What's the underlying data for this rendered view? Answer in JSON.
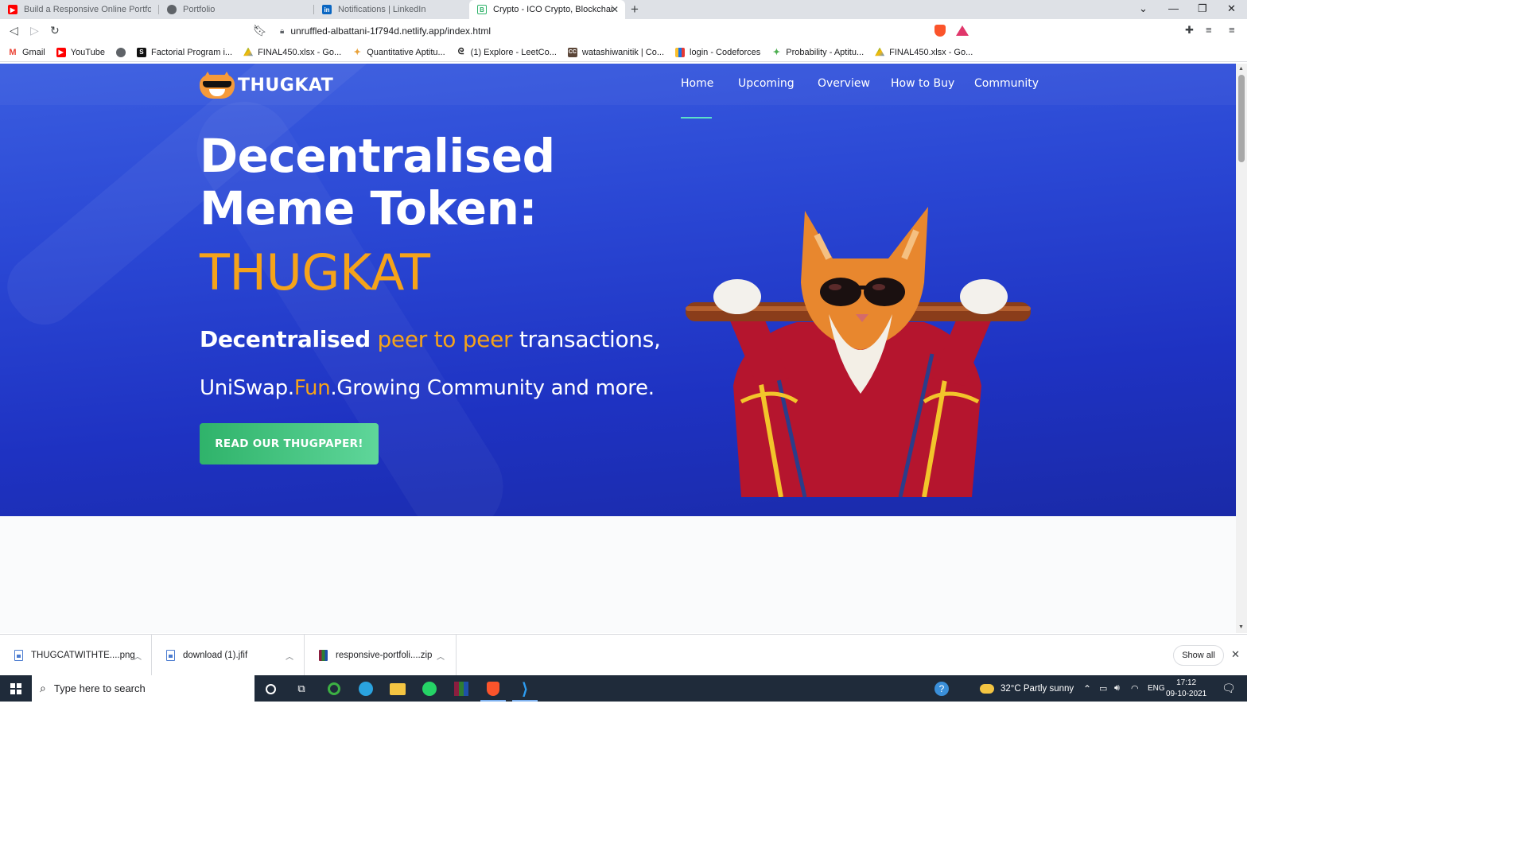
{
  "browser": {
    "tabs": [
      {
        "title": "Build a Responsive Online Portfolio fro",
        "favicon": "youtube-icon",
        "color": "#ff0000",
        "active": false
      },
      {
        "title": "Portfolio",
        "favicon": "globe-icon",
        "color": "#5f6368",
        "active": false
      },
      {
        "title": "Notifications | LinkedIn",
        "favicon": "linkedin-icon",
        "color": "#0a66c2",
        "active": false
      },
      {
        "title": "Crypto - ICO Crypto, Blockchain & ",
        "favicon": "bootstrap-icon",
        "color": "#7952b3",
        "active": true
      }
    ],
    "url": "unruffled-albattani-1f794d.netlify.app/index.html",
    "bookmarks": [
      {
        "label": "Gmail",
        "icon": "gmail-icon",
        "color": "#ea4335"
      },
      {
        "label": "YouTube",
        "icon": "youtube-icon",
        "color": "#ff0000"
      },
      {
        "label": "",
        "icon": "globe-icon",
        "color": "#5f6368"
      },
      {
        "label": "Factorial Program i...",
        "icon": "s-icon",
        "color": "#111111"
      },
      {
        "label": "FINAL450.xlsx - Go...",
        "icon": "drive-icon",
        "color": "#fbbc04"
      },
      {
        "label": "Quantitative Aptitu...",
        "icon": "aptitude-icon",
        "color": "#e8a23a"
      },
      {
        "label": "(1) Explore - LeetCo...",
        "icon": "leetcode-icon",
        "color": "#e7a41f"
      },
      {
        "label": "watashiwanitik | Co...",
        "icon": "codechef-icon",
        "color": "#5b4638"
      },
      {
        "label": "login - Codeforces",
        "icon": "codeforces-icon",
        "color": "#1a73e8"
      },
      {
        "label": "Probability - Aptitu...",
        "icon": "aptitude-icon",
        "color": "#4caf50"
      },
      {
        "label": "FINAL450.xlsx - Go...",
        "icon": "drive-icon",
        "color": "#fbbc04"
      }
    ]
  },
  "site": {
    "logo_text": "THUGKAT",
    "nav": [
      "Home",
      "Upcoming",
      "Overview",
      "How to Buy",
      "Community"
    ],
    "active_nav": "Home",
    "headline_line1": "Decentralised",
    "headline_line2": "Meme Token:",
    "headline_line3": "THUGKAT",
    "sub1_part1": "Decentralised",
    "sub1_part2": "peer to peer",
    "sub1_part3": "transactions,",
    "sub2_part1": "UniSwap.",
    "sub2_part2": "Fun",
    "sub2_part3": ".Growing Community and more.",
    "cta_label": "READ OUR THUGPAPER!",
    "colors": {
      "accent": "#f5a31a",
      "cta": "#3fbf7a",
      "hero": "#2a47d4",
      "nav_underline": "#5ce0c8"
    }
  },
  "downloads": {
    "items": [
      {
        "name": "THUGCATWITHTE....png",
        "icon": "image-file-icon"
      },
      {
        "name": "download (1).jfif",
        "icon": "image-file-icon"
      },
      {
        "name": "responsive-portfoli....zip",
        "icon": "winrar-icon"
      }
    ],
    "show_all": "Show all"
  },
  "taskbar": {
    "search_placeholder": "Type here to search",
    "weather": "32°C  Partly sunny",
    "language": "ENG",
    "time": "17:12",
    "date": "09-10-2021"
  }
}
